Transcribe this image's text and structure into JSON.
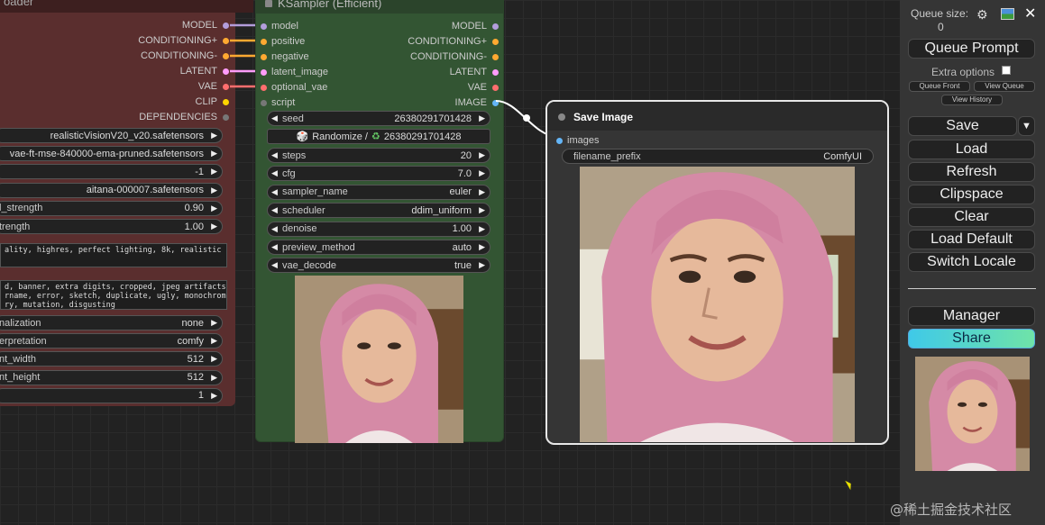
{
  "loader": {
    "title": "oader",
    "outputs": [
      {
        "label": "MODEL",
        "color": "#b39ddb"
      },
      {
        "label": "CONDITIONING+",
        "color": "#ffa931"
      },
      {
        "label": "CONDITIONING-",
        "color": "#ffa931"
      },
      {
        "label": "LATENT",
        "color": "#ff9cf9"
      },
      {
        "label": "VAE",
        "color": "#ff6e6e"
      },
      {
        "label": "CLIP",
        "color": "#ffd500"
      },
      {
        "label": "DEPENDENCIES",
        "color": "#777777"
      }
    ],
    "widgets": [
      {
        "label": "",
        "value": "realisticVisionV20_v20.safetensors"
      },
      {
        "label": "",
        "value": "vae-ft-mse-840000-ema-pruned.safetensors"
      },
      {
        "label": "",
        "value": "-1"
      },
      {
        "label": "",
        "value": "aitana-000007.safetensors"
      },
      {
        "label": "l_strength",
        "value": "0.90"
      },
      {
        "label": "trength",
        "value": "1.00"
      }
    ],
    "positive_text": "ality, highres, perfect lighting, 8k, realistic",
    "negative_text": "d, banner, extra digits, cropped, jpeg artifacts,\nrname, error, sketch, duplicate, ugly, monochrome,\nry, mutation, disgusting",
    "widgets2": [
      {
        "label": "nalization",
        "value": "none"
      },
      {
        "label": "erpretation",
        "value": "comfy"
      },
      {
        "label": "nt_width",
        "value": "512"
      },
      {
        "label": "nt_height",
        "value": "512"
      },
      {
        "label": "",
        "value": "1"
      }
    ]
  },
  "ksampler": {
    "title": "KSampler (Efficient)",
    "inputs": [
      {
        "label": "model",
        "color": "#b39ddb"
      },
      {
        "label": "positive",
        "color": "#ffa931"
      },
      {
        "label": "negative",
        "color": "#ffa931"
      },
      {
        "label": "latent_image",
        "color": "#ff9cf9"
      },
      {
        "label": "optional_vae",
        "color": "#ff6e6e"
      },
      {
        "label": "script",
        "color": "#777777"
      }
    ],
    "outputs": [
      {
        "label": "MODEL",
        "color": "#b39ddb"
      },
      {
        "label": "CONDITIONING+",
        "color": "#ffa931"
      },
      {
        "label": "CONDITIONING-",
        "color": "#ffa931"
      },
      {
        "label": "LATENT",
        "color": "#ff9cf9"
      },
      {
        "label": "VAE",
        "color": "#ff6e6e"
      },
      {
        "label": "IMAGE",
        "color": "#64b5f6"
      }
    ],
    "seed": {
      "label": "seed",
      "value": "26380291701428"
    },
    "randomize": {
      "label": "Randomize /",
      "value": "26380291701428"
    },
    "widgets": [
      {
        "label": "steps",
        "value": "20"
      },
      {
        "label": "cfg",
        "value": "7.0"
      },
      {
        "label": "sampler_name",
        "value": "euler"
      },
      {
        "label": "scheduler",
        "value": "ddim_uniform"
      },
      {
        "label": "denoise",
        "value": "1.00"
      },
      {
        "label": "preview_method",
        "value": "auto"
      },
      {
        "label": "vae_decode",
        "value": "true"
      }
    ]
  },
  "save_image": {
    "title": "Save Image",
    "input": {
      "label": "images",
      "color": "#64b5f6"
    },
    "filename_prefix": {
      "label": "filename_prefix",
      "value": "ComfyUI"
    }
  },
  "menu": {
    "queue_size_label": "Queue size:",
    "queue_size_value": "0",
    "queue_prompt": "Queue Prompt",
    "extra_options": "Extra options",
    "queue_front": "Queue Front",
    "view_queue": "View Queue",
    "view_history": "View History",
    "save": "Save",
    "dropdown": "▼",
    "load": "Load",
    "refresh": "Refresh",
    "clipspace": "Clipspace",
    "clear": "Clear",
    "load_default": "Load Default",
    "switch_locale": "Switch Locale",
    "manager": "Manager",
    "share": "Share"
  },
  "watermark": "@稀土掘金技术社区"
}
